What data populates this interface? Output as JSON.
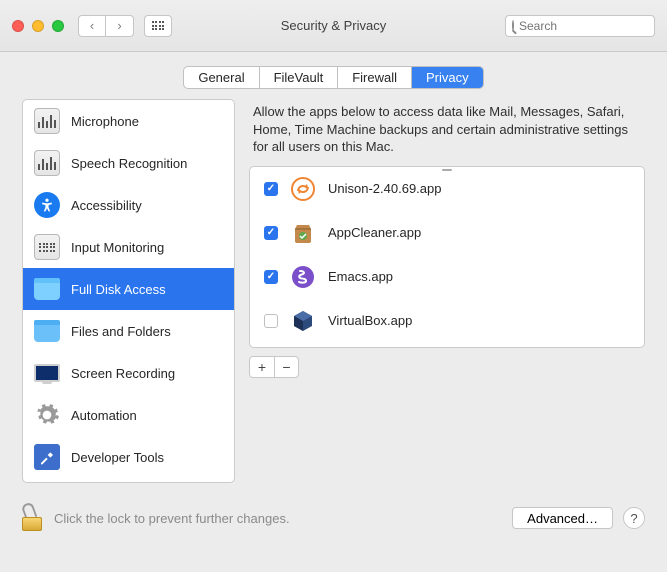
{
  "window": {
    "title": "Security & Privacy"
  },
  "search": {
    "placeholder": "Search"
  },
  "tabs": [
    {
      "label": "General",
      "active": false
    },
    {
      "label": "FileVault",
      "active": false
    },
    {
      "label": "Firewall",
      "active": false
    },
    {
      "label": "Privacy",
      "active": true
    }
  ],
  "sidebar": {
    "items": [
      {
        "id": "microphone",
        "label": "Microphone",
        "icon": "waveform-icon",
        "selected": false
      },
      {
        "id": "speech-recognition",
        "label": "Speech Recognition",
        "icon": "waveform-icon",
        "selected": false
      },
      {
        "id": "accessibility",
        "label": "Accessibility",
        "icon": "accessibility-icon",
        "selected": false
      },
      {
        "id": "input-monitoring",
        "label": "Input Monitoring",
        "icon": "keyboard-icon",
        "selected": false
      },
      {
        "id": "full-disk-access",
        "label": "Full Disk Access",
        "icon": "folder-icon",
        "selected": true
      },
      {
        "id": "files-and-folders",
        "label": "Files and Folders",
        "icon": "folder-icon",
        "selected": false
      },
      {
        "id": "screen-recording",
        "label": "Screen Recording",
        "icon": "display-icon",
        "selected": false
      },
      {
        "id": "automation",
        "label": "Automation",
        "icon": "gear-icon",
        "selected": false
      },
      {
        "id": "developer-tools",
        "label": "Developer Tools",
        "icon": "hammer-icon",
        "selected": false
      }
    ]
  },
  "content": {
    "description": "Allow the apps below to access data like Mail, Messages, Safari, Home, Time Machine backups and certain administrative settings for all users on this Mac."
  },
  "apps": [
    {
      "name": "Unison-2.40.69.app",
      "checked": true,
      "icon": "unison"
    },
    {
      "name": "AppCleaner.app",
      "checked": true,
      "icon": "appcleaner"
    },
    {
      "name": "Emacs.app",
      "checked": true,
      "icon": "emacs"
    },
    {
      "name": "VirtualBox.app",
      "checked": false,
      "icon": "virtualbox"
    }
  ],
  "controls": {
    "add_label": "+",
    "remove_label": "−"
  },
  "footer": {
    "lock_text": "Click the lock to prevent further changes.",
    "advanced_label": "Advanced…",
    "help_label": "?"
  }
}
